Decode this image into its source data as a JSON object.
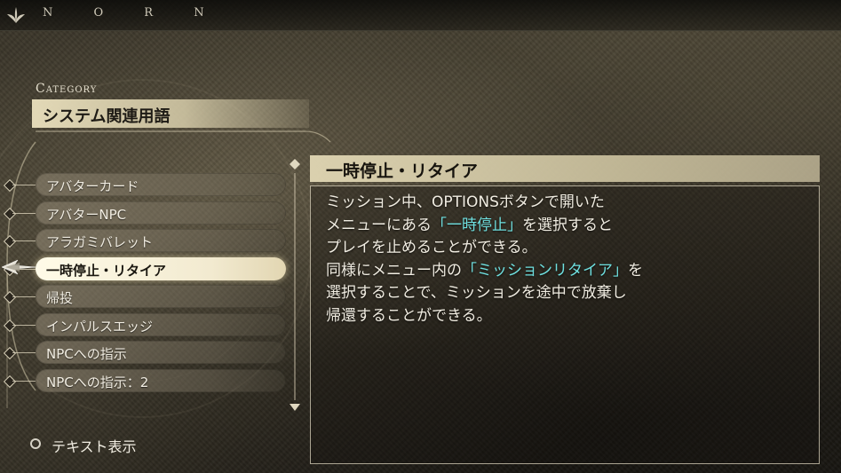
{
  "header": {
    "logo_text": "N O R N",
    "logo_icon": "leaf-emblem-icon"
  },
  "category": {
    "label": "Category",
    "name": "システム関連用語"
  },
  "list": {
    "items": [
      {
        "label": "アバターカード",
        "selected": false
      },
      {
        "label": "アバターNPC",
        "selected": false
      },
      {
        "label": "アラガミバレット",
        "selected": false
      },
      {
        "label": "一時停止・リタイア",
        "selected": true
      },
      {
        "label": "帰投",
        "selected": false
      },
      {
        "label": "インパルスエッジ",
        "selected": false
      },
      {
        "label": "NPCへの指示",
        "selected": false
      },
      {
        "label": "NPCへの指示：2",
        "selected": false
      }
    ],
    "scroll_up_icon": "diamond-up-arrow-icon",
    "scroll_down_icon": "diamond-down-arrow-icon",
    "cursor_icon": "winged-pointer-icon"
  },
  "detail": {
    "title": "一時停止・リタイア",
    "lines": [
      [
        {
          "text": "ミッション中、OPTIONSボタンで開いた",
          "highlight": false
        }
      ],
      [
        {
          "text": "メニューにある",
          "highlight": false
        },
        {
          "text": "「一時停止」",
          "highlight": true
        },
        {
          "text": "を選択すると",
          "highlight": false
        }
      ],
      [
        {
          "text": "プレイを止めることができる。",
          "highlight": false
        }
      ],
      [
        {
          "text": "同様にメニュー内の",
          "highlight": false
        },
        {
          "text": "「ミッションリタイア」",
          "highlight": true
        },
        {
          "text": "を",
          "highlight": false
        }
      ],
      [
        {
          "text": "選択することで、ミッションを途中で放棄し",
          "highlight": false
        }
      ],
      [
        {
          "text": "帰還することができる。",
          "highlight": false
        }
      ]
    ],
    "highlight_color": "#6fe0e0"
  },
  "footer": {
    "button_icon": "circle-button-icon",
    "hint_label": "テキスト表示"
  }
}
